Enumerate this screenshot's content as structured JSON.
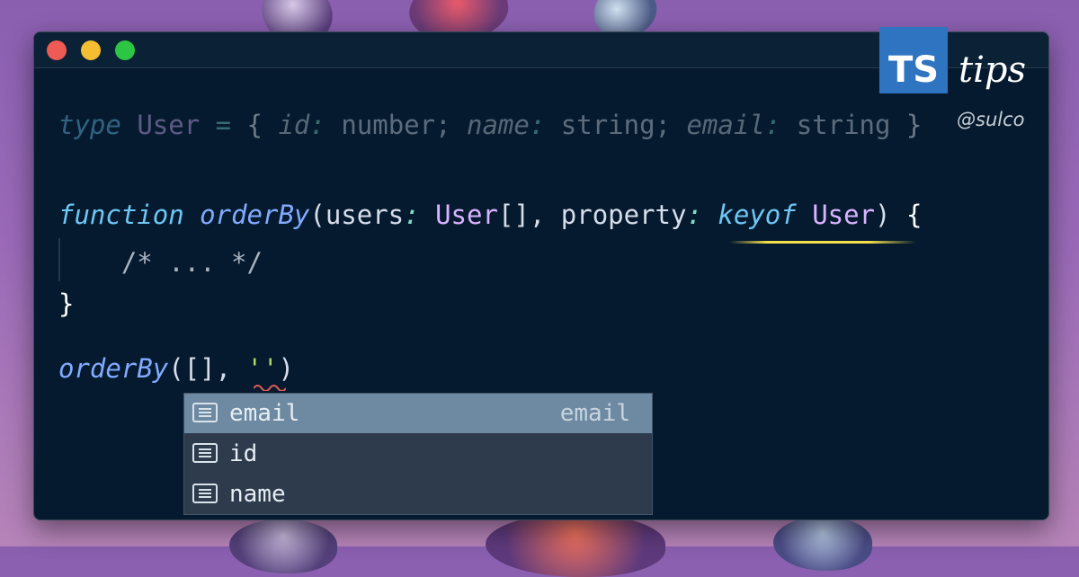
{
  "window": {
    "traffic_lights": {
      "close": "#ee5b55",
      "minimize": "#f4bd32",
      "zoom": "#2dc644"
    }
  },
  "editor": {
    "line1": {
      "kw_type": "type",
      "name": "User",
      "eq": " = ",
      "open": "{ ",
      "p1": "id",
      "c1": ":",
      "t1": " number; ",
      "p2": "name",
      "c2": ":",
      "t2": " string; ",
      "p3": "email",
      "c3": ":",
      "t3": " string ",
      "close": "}"
    },
    "line2": {
      "kw_function": "function",
      "space": " ",
      "fn_name": "orderBy",
      "open_paren": "(",
      "param1": "users",
      "colon1": ":",
      "space1": " ",
      "type1": "User",
      "arr": "[], ",
      "param2": "property",
      "colon2": ":",
      "space2": " ",
      "kw_keyof": "keyof",
      "space3": " ",
      "type2": "User",
      "close_paren": ") ",
      "brace": "{"
    },
    "line3": {
      "comment": "    /* ... */"
    },
    "line4": {
      "brace": "}"
    },
    "line5": {
      "fn_name": "orderBy",
      "args": "([], ",
      "string": "''",
      "close": ")"
    }
  },
  "suggestions": {
    "items": [
      {
        "label": "email",
        "detail": "email",
        "icon": "field-icon",
        "selected": true
      },
      {
        "label": "id",
        "detail": "",
        "icon": "field-icon",
        "selected": false
      },
      {
        "label": "name",
        "detail": "",
        "icon": "field-icon",
        "selected": false
      }
    ]
  },
  "badge": {
    "ts": "TS",
    "tips": "tips",
    "handle": "@sulco",
    "ts_color": "#2f74c0"
  }
}
